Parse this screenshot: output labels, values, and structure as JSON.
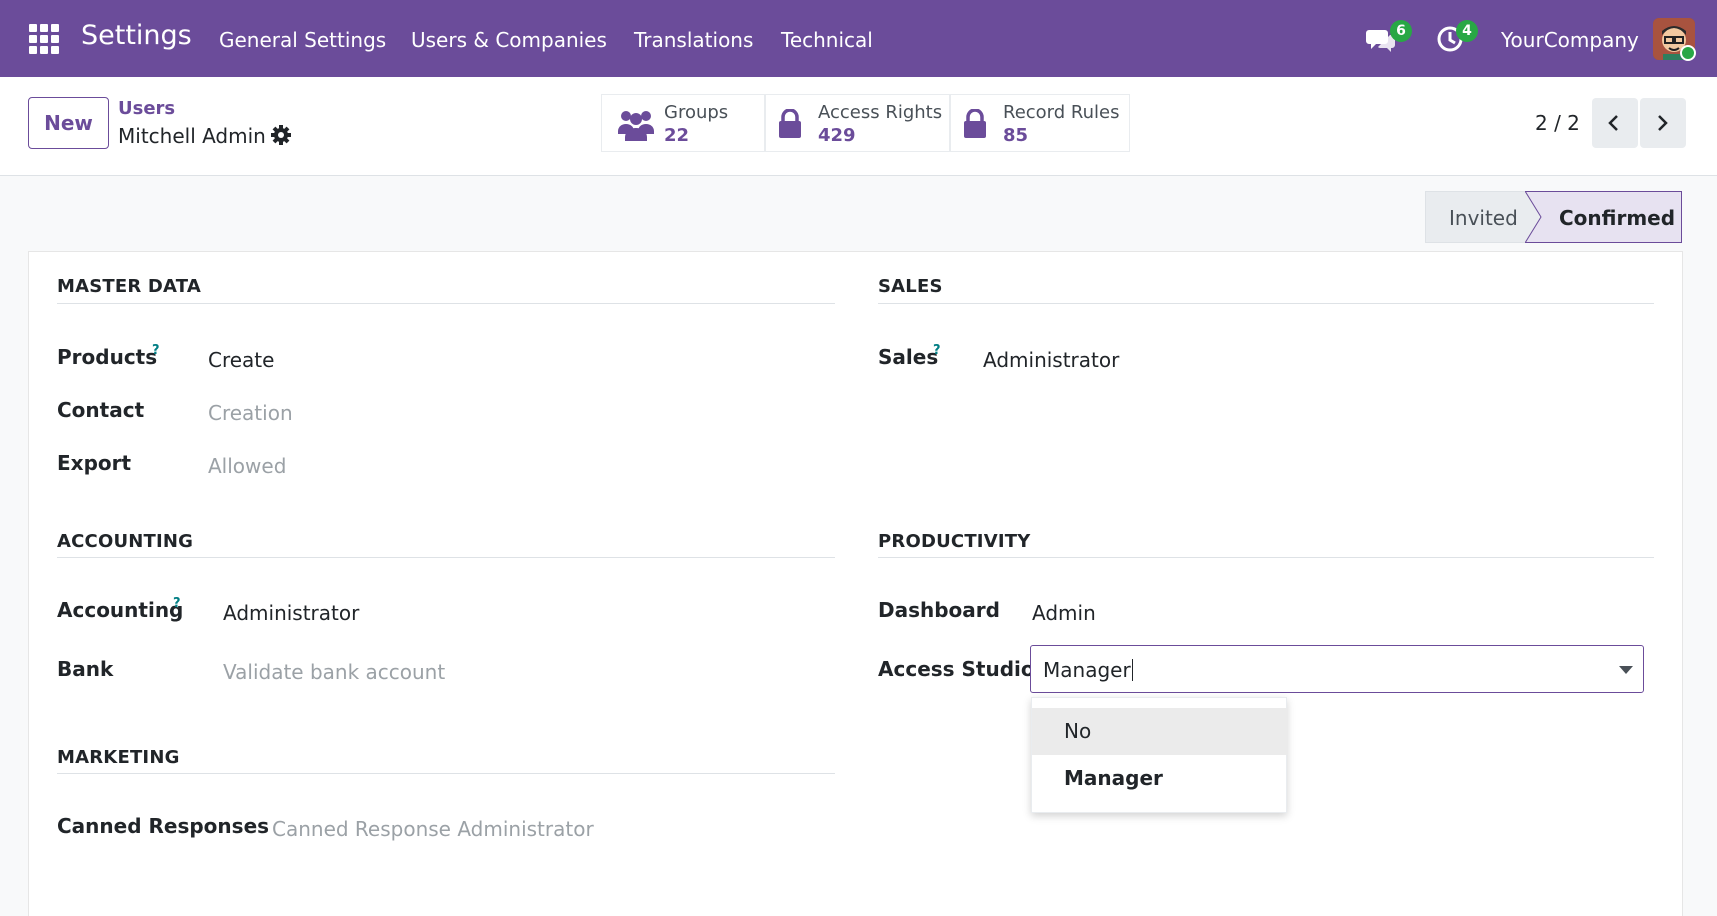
{
  "navbar": {
    "app_title": "Settings",
    "menu": [
      "General Settings",
      "Users & Companies",
      "Translations",
      "Technical"
    ],
    "messages_count": "6",
    "activities_count": "4",
    "company": "YourCompany",
    "color": "#6b4c9a"
  },
  "control_panel": {
    "new_label": "New",
    "breadcrumb_parent": "Users",
    "breadcrumb_current": "Mitchell Admin",
    "stats": [
      {
        "label": "Groups",
        "value": "22",
        "icon": "users-icon"
      },
      {
        "label": "Access Rights",
        "value": "429",
        "icon": "lock-icon"
      },
      {
        "label": "Record Rules",
        "value": "85",
        "icon": "lock-icon"
      }
    ],
    "pager": "2 / 2"
  },
  "status": {
    "invited": "Invited",
    "confirmed": "Confirmed"
  },
  "form": {
    "master_data": {
      "title": "MASTER DATA",
      "products_label": "Products",
      "products_value": "Create",
      "contact_label": "Contact",
      "contact_value": "Creation",
      "export_label": "Export",
      "export_value": "Allowed"
    },
    "sales": {
      "title": "SALES",
      "sales_label": "Sales",
      "sales_value": "Administrator"
    },
    "accounting": {
      "title": "ACCOUNTING",
      "accounting_label": "Accounting",
      "accounting_value": "Administrator",
      "bank_label": "Bank",
      "bank_value": "Validate bank account"
    },
    "productivity": {
      "title": "PRODUCTIVITY",
      "dashboard_label": "Dashboard",
      "dashboard_value": "Admin",
      "studio_label": "Access Studio",
      "studio_value": "Manager"
    },
    "marketing": {
      "title": "MARKETING",
      "canned_label": "Canned Responses",
      "canned_value": "Canned Response Administrator"
    },
    "help_mark": "?"
  },
  "dropdown": {
    "options": [
      "No",
      "Manager"
    ]
  }
}
